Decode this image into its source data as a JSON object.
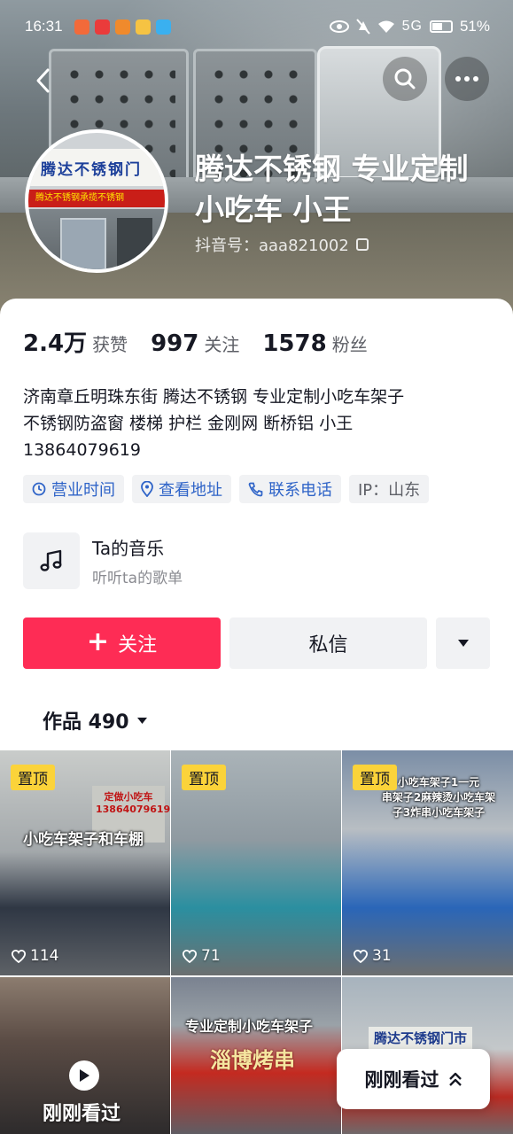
{
  "status_bar": {
    "time": "16:31",
    "signal": "5G",
    "battery": "51%",
    "battery_level": 0.51
  },
  "profile": {
    "name": "腾达不锈钢 专业定制小吃车 小王",
    "douyin_id": "抖音号：aaa821002",
    "avatar_sign_text": "腾达不锈钢门",
    "avatar_banner_text": "腾达不锈钢承揽不锈钢"
  },
  "stats": [
    {
      "num": "2.4万",
      "label": "获赞"
    },
    {
      "num": "997",
      "label": "关注"
    },
    {
      "num": "1578",
      "label": "粉丝"
    }
  ],
  "bio": "济南章丘明珠东街 腾达不锈钢  专业定制小吃车架子\n不锈钢防盗窗  楼梯 护栏 金刚网  断桥铝 小王\n13864079619",
  "tags": [
    {
      "label": "营业时间",
      "icon": "clock-icon"
    },
    {
      "label": "查看地址",
      "icon": "location-pin-icon"
    },
    {
      "label": "联系电话",
      "icon": "phone-icon"
    },
    {
      "label": "IP：山东",
      "icon": ""
    }
  ],
  "music": {
    "title": "Ta的音乐",
    "subtitle": "听听ta的歌单"
  },
  "actions": {
    "follow": "关注",
    "message": "私信"
  },
  "works_tab": "作品 490",
  "grid": [
    {
      "pin": "置顶",
      "likes": "114",
      "overlay": "小吃车架子和车棚",
      "sign": "定做小吃车\n13864079619"
    },
    {
      "pin": "置顶",
      "likes": "71",
      "overlay": "",
      "sign": ""
    },
    {
      "pin": "置顶",
      "likes": "31",
      "overlay": "小吃车架子1一元\n串架子2麻辣烫小吃车架\n子3炸串小吃车架子",
      "sign": ""
    },
    {
      "caption": "刚刚看过"
    },
    {
      "overlay": "专业定制小吃车架子",
      "sign": "淄博烤串"
    },
    {
      "overlay": "",
      "sign": "腾达不锈钢门市"
    }
  ],
  "recent_button": "刚刚看过",
  "colors": {
    "accent": "#fe2c55",
    "tag_text": "#2f64c8",
    "pin_bg": "#fbd33a"
  }
}
